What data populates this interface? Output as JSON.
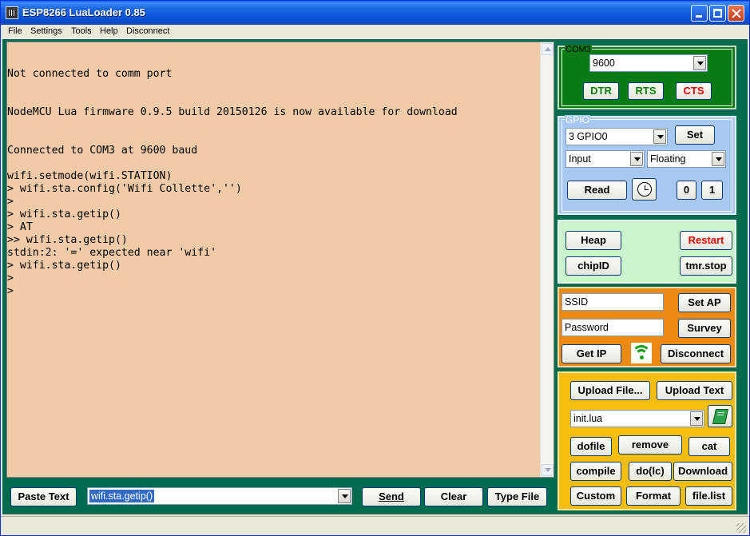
{
  "window": {
    "title": "ESP8266 LuaLoader 0.85"
  },
  "menu": [
    "File",
    "Settings",
    "Tools",
    "Help",
    "Disconnect"
  ],
  "terminal": {
    "text": "\n\nNot connected to comm port\n\n\nNodeMCU Lua firmware 0.9.5 build 20150126 is now available for download\n\n\nConnected to COM3 at 9600 baud\n\nwifi.setmode(wifi.STATION)\n> wifi.sta.config('Wifi Collette','')\n>\n> wifi.sta.getip()\n> AT\n>> wifi.sta.getip()\nstdin:2: '=' expected near 'wifi'\n> wifi.sta.getip()\n>\n>"
  },
  "bottom": {
    "paste_label": "Paste Text",
    "command_value": "wifi.sta.getip()",
    "send_label": "Send",
    "clear_label": "Clear",
    "typefile_label": "Type File"
  },
  "com": {
    "port_label": "COM3",
    "baud": "9600",
    "dtr": "DTR",
    "rts": "RTS",
    "cts": "CTS"
  },
  "gpio": {
    "label": "GPIO",
    "pin": "3 GPIO0",
    "set": "Set",
    "mode": "Input",
    "pull": "Floating",
    "read": "Read",
    "zero": "0",
    "one": "1"
  },
  "system": {
    "heap": "Heap",
    "restart": "Restart",
    "chipid": "chipID",
    "tmrstop": "tmr.stop"
  },
  "wifi": {
    "ssid_value": "SSID",
    "password_value": "Password",
    "setap": "Set AP",
    "survey": "Survey",
    "getip": "Get IP",
    "disconnect": "Disconnect"
  },
  "files": {
    "upload_file": "Upload File...",
    "upload_text": "Upload Text",
    "selected_file": "init.lua",
    "dofile": "dofile",
    "remove": "remove",
    "cat": "cat",
    "compile": "compile",
    "dolc": "do(lc)",
    "download": "Download",
    "custom": "Custom",
    "format": "Format",
    "filelist": "file.list"
  },
  "colors": {
    "terminal_bg": "#f1cba8",
    "client_bg": "#006b4f",
    "com_panel": "#0a7a14",
    "gpio_panel": "#a7c8f0",
    "heap_panel": "#c9f4cd",
    "wifi_panel": "#ee8a12",
    "file_panel": "#f6be0c",
    "restart_text": "#e00000",
    "cts_text": "#e00000",
    "green_text": "#008000"
  }
}
